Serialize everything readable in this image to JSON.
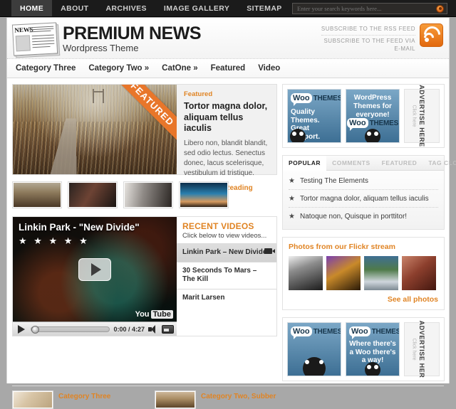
{
  "topnav": {
    "items": [
      {
        "label": "HOME",
        "active": true
      },
      {
        "label": "ABOUT",
        "active": false
      },
      {
        "label": "ARCHIVES",
        "active": false
      },
      {
        "label": "IMAGE GALLERY",
        "active": false
      },
      {
        "label": "SITEMAP",
        "active": false
      }
    ],
    "search": {
      "placeholder": "Enter your search keywords here...",
      "value": "",
      "button_icon": "search-go-icon"
    }
  },
  "masthead": {
    "logo_icon": "newspaper-icon",
    "logo_word": "NEWS",
    "title": "PREMIUM NEWS",
    "subtitle": "Wordpress Theme",
    "rss": {
      "line1": "SUBSCRIBE TO THE RSS FEED",
      "line2": "SUBSCRIBE TO THE FEED VIA",
      "line3": "E-MAIL",
      "icon": "rss-feed-icon"
    }
  },
  "catnav": {
    "items": [
      {
        "label": "Category Three"
      },
      {
        "label": "Category Two »"
      },
      {
        "label": "CatOne »"
      },
      {
        "label": "Featured"
      },
      {
        "label": "Video"
      }
    ]
  },
  "featured": {
    "ribbon": "FEATURED",
    "kicker": "Featured",
    "title": "Tortor magna dolor, aliquam tellus iaculis",
    "body": "Libero non, blandit blandit, sed odio lectus. Senectus donec, lacus scelerisque, vestibulum id tristique.",
    "more": "➔ Continue Reading"
  },
  "thumbs": [
    {
      "name": "thumb-boardwalk"
    },
    {
      "name": "thumb-street"
    },
    {
      "name": "thumb-portrait"
    },
    {
      "name": "thumb-seascape"
    }
  ],
  "video": {
    "title": "Linkin Park - \"New Divide\"",
    "stars": "★ ★ ★ ★ ★",
    "play_icon": "play-icon",
    "brand": "You",
    "brand_box": "Tube",
    "controls": {
      "play_icon": "play-icon",
      "time": "0:00 / 4:27",
      "volume_icon": "volume-icon",
      "fullscreen_icon": "fullscreen-icon"
    },
    "recent": {
      "heading": "RECENT VIDEOS",
      "sub": "Click below to view videos...",
      "items": [
        {
          "label": "Linkin Park – New Divide",
          "selected": true,
          "icon": "video-camera-icon"
        },
        {
          "label": "30 Seconds To Mars – The Kill",
          "selected": false
        },
        {
          "label": "Marit Larsen",
          "selected": false
        }
      ]
    }
  },
  "ads_top": {
    "ad1": {
      "brand_bubble": "Woo",
      "brand_rest": "THEMES",
      "line": "Quality Themes. Great Support.",
      "mascot": "ninja-mascot-icon"
    },
    "ad2": {
      "center": "WordPress Themes for everyone!",
      "brand_bubble": "Woo",
      "brand_rest": "THEMES",
      "mascot": "ninja-mascot-icon"
    },
    "advertise": {
      "title": "ADVERTISE HERE",
      "sub": "Click here"
    }
  },
  "tabbox": {
    "tabs": [
      {
        "label": "POPULAR",
        "active": true
      },
      {
        "label": "COMMENTS",
        "active": false
      },
      {
        "label": "FEATURED",
        "active": false
      },
      {
        "label": "TAG CLOUD",
        "active": false
      }
    ],
    "items": [
      {
        "icon": "star-icon",
        "label": "Testing The Elements"
      },
      {
        "icon": "star-icon",
        "label": "Tortor magna dolor, aliquam tellus iaculis"
      },
      {
        "icon": "star-icon",
        "label": "Natoque non, Quisque in porttitor!"
      }
    ]
  },
  "flickr": {
    "heading": "Photos from our Flickr stream",
    "photos": [
      {
        "name": "flickr-photo-buildings"
      },
      {
        "name": "flickr-photo-lights"
      },
      {
        "name": "flickr-photo-landscape"
      },
      {
        "name": "flickr-photo-archway"
      }
    ],
    "see_all": "See all photos"
  },
  "ads_bottom": {
    "ad1": {
      "brand_bubble": "Woo",
      "brand_rest": "THEMES",
      "mascot": "ninja-mascot-icon"
    },
    "ad2": {
      "brand_bubble": "Woo",
      "brand_rest": "THEMES",
      "center": "Where there's a Woo there's a way!",
      "mascot": "ninja-mascot-icon"
    },
    "advertise": {
      "title": "ADVERTISE HER",
      "sub": "Click here"
    }
  },
  "bottom_posts": [
    {
      "category": "Category Three",
      "thumb": "post-thumb-flowers"
    },
    {
      "category": "Category Two, Subber",
      "thumb": "post-thumb-field"
    }
  ],
  "colors": {
    "accent": "#e08424",
    "ribbon": "#e8762a",
    "topbar": "#1b1b1b",
    "page_bg": "#a8a8a8"
  }
}
